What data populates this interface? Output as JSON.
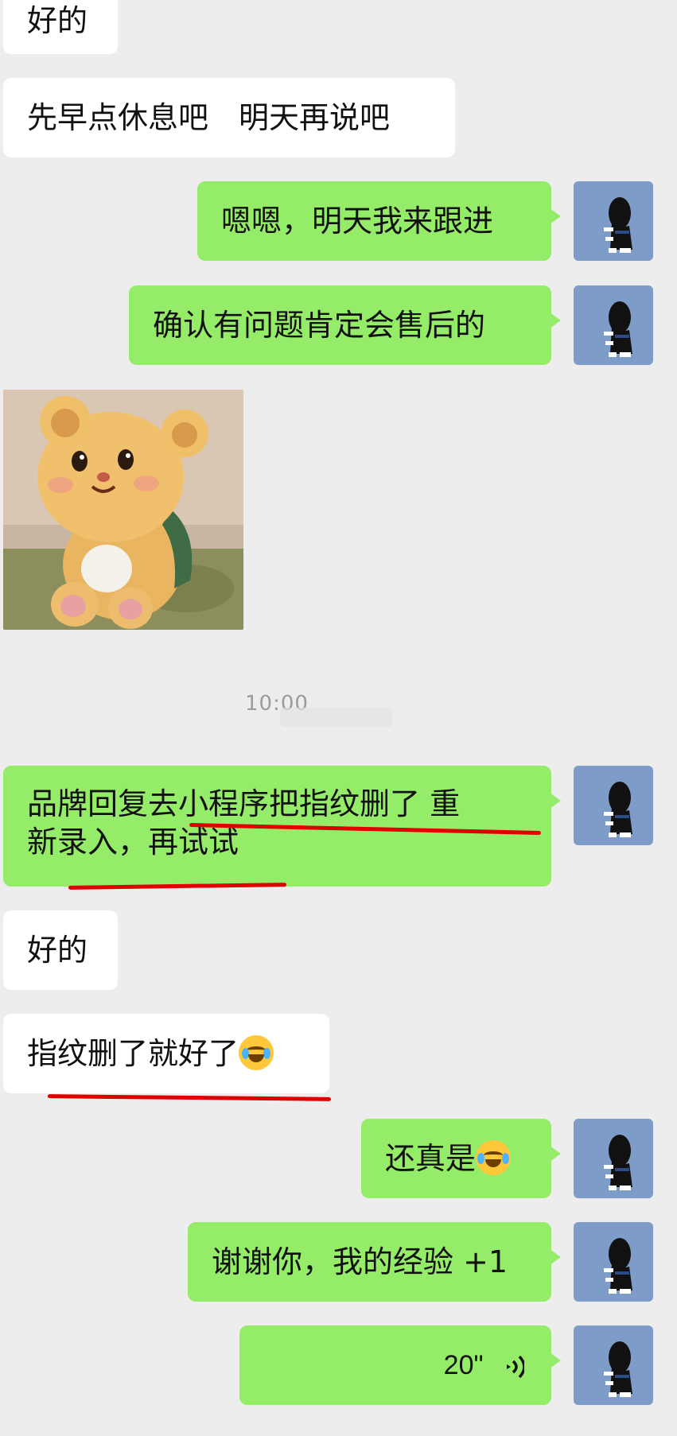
{
  "messages": {
    "m1": "好的",
    "m2": "先早点休息吧　明天再说吧",
    "m3": "嗯嗯，明天我来跟进",
    "m4": "确认有问题肯定会售后的",
    "m6_line1": "品牌回复去小程序把指纹删了  重",
    "m6_line2": "新录入，再试试",
    "m7": "好的",
    "m8": "指纹删了就好了",
    "m9": "还真是",
    "m10": "谢谢你，我的经验 +1",
    "voice_duration": "20\""
  },
  "timestamp": "10:00",
  "emoji": {
    "m8": "face-with-tears-icon",
    "m9": "tears-of-joy-icon"
  },
  "colors": {
    "background": "#ededed",
    "incoming_bubble": "#ffffff",
    "outgoing_bubble": "#95ec69",
    "annotation_underline": "#e00000",
    "avatar_bg": "#7e9cc8"
  },
  "photo": {
    "subject": "teddy-bear-sticker"
  }
}
